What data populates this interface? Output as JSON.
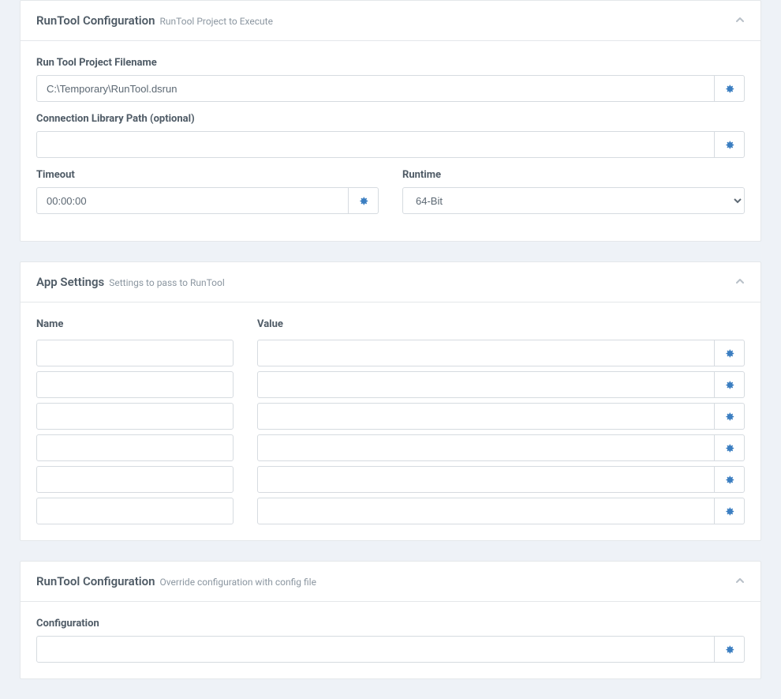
{
  "panel1": {
    "title": "RunTool Configuration",
    "subtitle": "RunTool Project to Execute",
    "filename_label": "Run Tool Project Filename",
    "filename_value": "C:\\Temporary\\RunTool.dsrun",
    "libpath_label": "Connection Library Path (optional)",
    "libpath_value": "",
    "timeout_label": "Timeout",
    "timeout_value": "00:00:00",
    "runtime_label": "Runtime",
    "runtime_value": "64-Bit"
  },
  "panel2": {
    "title": "App Settings",
    "subtitle": "Settings to pass to RunTool",
    "name_header": "Name",
    "value_header": "Value",
    "rows": [
      {
        "name": "",
        "value": ""
      },
      {
        "name": "",
        "value": ""
      },
      {
        "name": "",
        "value": ""
      },
      {
        "name": "",
        "value": ""
      },
      {
        "name": "",
        "value": ""
      },
      {
        "name": "",
        "value": ""
      }
    ]
  },
  "panel3": {
    "title": "RunTool Configuration",
    "subtitle": "Override configuration with config file",
    "config_label": "Configuration",
    "config_value": ""
  }
}
